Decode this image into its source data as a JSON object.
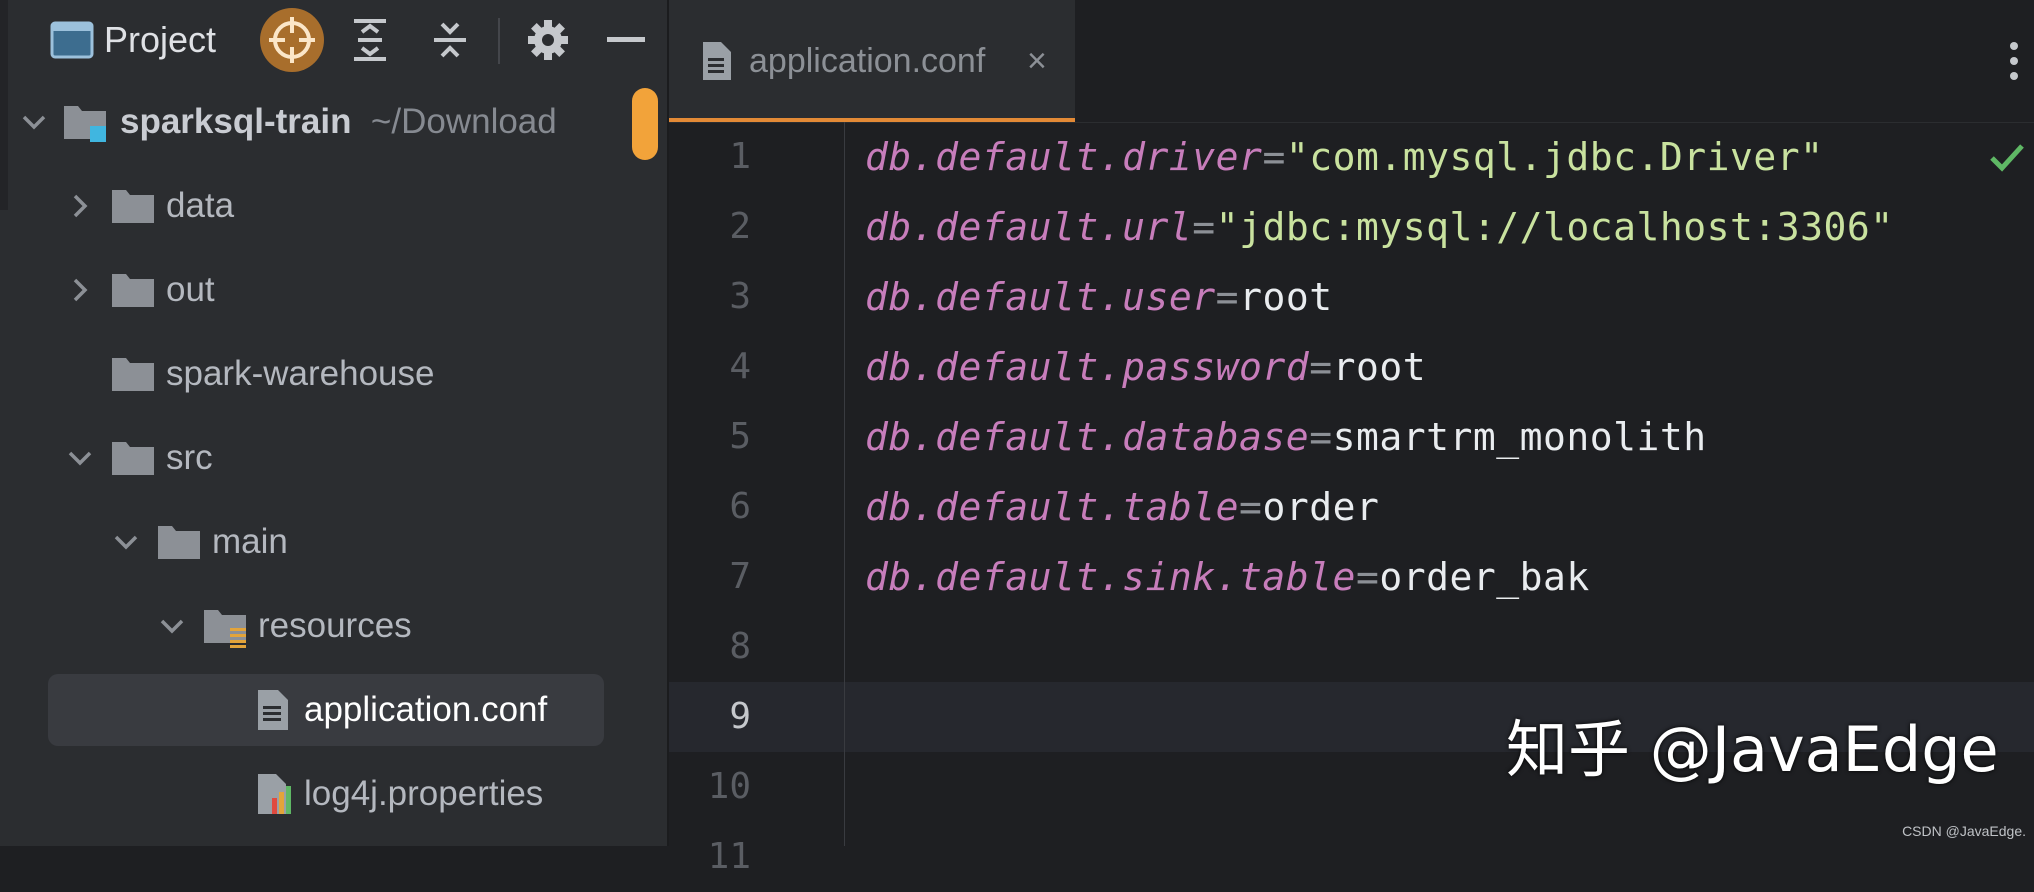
{
  "project_panel": {
    "title": "Project",
    "toolbar_icons": [
      "project-view-icon",
      "locate-icon",
      "expand-all-icon",
      "collapse-all-icon",
      "settings-icon",
      "hide-icon"
    ],
    "tree": [
      {
        "name": "sparksql-train",
        "suffix": "~/Download",
        "type": "module",
        "expanded": true,
        "depth": 0
      },
      {
        "name": "data",
        "type": "folder",
        "expanded": false,
        "depth": 1
      },
      {
        "name": "out",
        "type": "folder",
        "expanded": false,
        "depth": 1
      },
      {
        "name": "spark-warehouse",
        "type": "folder",
        "depth": 1
      },
      {
        "name": "src",
        "type": "folder",
        "expanded": true,
        "depth": 1
      },
      {
        "name": "main",
        "type": "folder",
        "expanded": true,
        "depth": 2
      },
      {
        "name": "resources",
        "type": "resources-folder",
        "expanded": true,
        "depth": 3
      },
      {
        "name": "application.conf",
        "type": "text-file",
        "selected": true,
        "depth": 4
      },
      {
        "name": "log4j.properties",
        "type": "properties-file",
        "depth": 4
      }
    ]
  },
  "editor": {
    "tab": {
      "label": "application.conf",
      "close": "×"
    },
    "line_numbers": [
      "1",
      "2",
      "3",
      "4",
      "5",
      "6",
      "7",
      "8",
      "9",
      "10",
      "11"
    ],
    "current_line": 9,
    "lines": [
      {
        "key": "db.default.driver",
        "eq": "=",
        "value": "\"com.mysql.jdbc.Driver\"",
        "string": true
      },
      {
        "key": "db.default.url",
        "eq": "=",
        "value": "\"jdbc:mysql://localhost:3306\"",
        "string": true
      },
      {
        "key": "db.default.user",
        "eq": "=",
        "value": "root",
        "string": false
      },
      {
        "key": "db.default.password",
        "eq": "=",
        "value": "root",
        "string": false
      },
      {
        "key": "db.default.database",
        "eq": "=",
        "value": "smartrm_monolith",
        "string": false
      },
      {
        "key": "db.default.table",
        "eq": "=",
        "value": "order",
        "string": false
      },
      {
        "key": "db.default.sink.table",
        "eq": "=",
        "value": "order_bak",
        "string": false
      }
    ]
  },
  "overlay": {
    "watermark": "知乎 @JavaEdge",
    "credit": "CSDN @JavaEdge."
  },
  "colors": {
    "key": "#c77dbb",
    "string": "#c9e29f",
    "value": "#e9ecef",
    "accent": "#e38a36",
    "scroll_marker": "#f2a33a",
    "check": "#5fb865"
  }
}
